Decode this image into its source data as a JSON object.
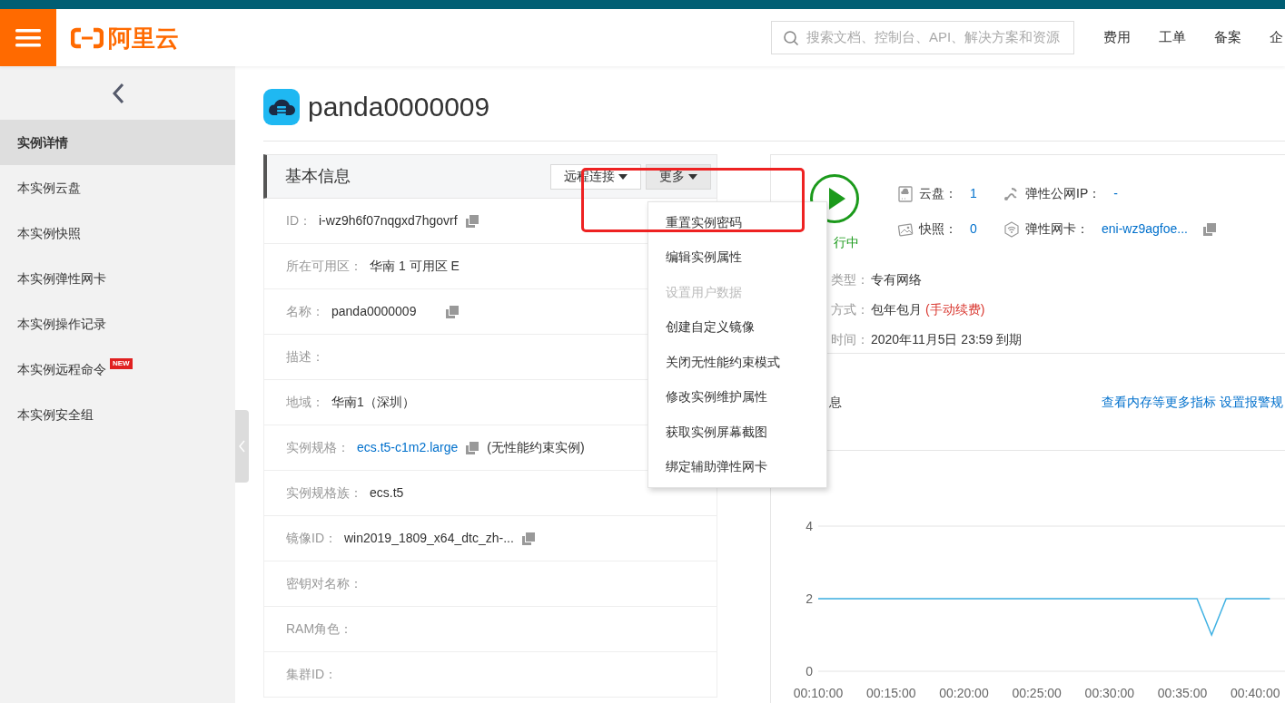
{
  "header": {
    "logo": "阿里云",
    "search": {
      "placeholder": "搜索文档、控制台、API、解决方案和资源"
    },
    "nav": [
      "费用",
      "工单",
      "备案",
      "企"
    ]
  },
  "sidebar": {
    "items": [
      {
        "label": "实例详情",
        "selected": true
      },
      {
        "label": "本实例云盘",
        "selected": false
      },
      {
        "label": "本实例快照",
        "selected": false
      },
      {
        "label": "本实例弹性网卡",
        "selected": false
      },
      {
        "label": "本实例操作记录",
        "selected": false
      },
      {
        "label": "本实例远程命令",
        "selected": false,
        "badge": "NEW"
      },
      {
        "label": "本实例安全组",
        "selected": false
      }
    ]
  },
  "instance": {
    "name": "panda0000009"
  },
  "basic_info": {
    "title": "基本信息",
    "buttons": [
      {
        "label": "远程连接",
        "active": false
      },
      {
        "label": "更多",
        "active": true
      }
    ],
    "rows": [
      {
        "label": "ID：",
        "value": "i-wz9h6f07nqgxd7hgovrf",
        "copy": true
      },
      {
        "label": "所在可用区：",
        "value": "华南 1 可用区 E"
      },
      {
        "label": "名称：",
        "value": "panda0000009",
        "copy": true
      },
      {
        "label": "描述："
      },
      {
        "label": "地域：",
        "value": "华南1（深圳）"
      },
      {
        "label": "实例规格：",
        "value": "ecs.t5-c1m2.large",
        "link": true,
        "copy": true,
        "note": "(无性能约束实例)"
      },
      {
        "label": "实例规格族：",
        "value": "ecs.t5"
      },
      {
        "label": "镜像ID：",
        "value": "win2019_1809_x64_dtc_zh-...",
        "copy": true
      },
      {
        "label": "密钥对名称："
      },
      {
        "label": "RAM角色："
      },
      {
        "label": "集群ID："
      }
    ]
  },
  "menu": {
    "items": [
      {
        "label": "重置实例密码",
        "disabled": false,
        "highlighted": true
      },
      {
        "label": "编辑实例属性",
        "disabled": false,
        "highlighted": false
      },
      {
        "label": "设置用户数据",
        "disabled": true,
        "highlighted": false
      },
      {
        "label": "创建自定义镜像",
        "disabled": false,
        "highlighted": false
      },
      {
        "label": "关闭无性能约束模式",
        "disabled": false,
        "highlighted": false
      },
      {
        "label": "修改实例维护属性",
        "disabled": false,
        "highlighted": false
      },
      {
        "label": "获取实例屏幕截图",
        "disabled": false,
        "highlighted": false
      },
      {
        "label": "绑定辅助弹性网卡",
        "disabled": false,
        "highlighted": false
      }
    ]
  },
  "status": {
    "label": "行中",
    "running": true
  },
  "stats": [
    {
      "kind": "disk",
      "label": "云盘：",
      "value": "1"
    },
    {
      "kind": "ip",
      "label": "弹性公网IP：",
      "value": "-"
    },
    {
      "kind": "snapshot",
      "label": "快照：",
      "value": "0"
    },
    {
      "kind": "nic",
      "label": "弹性网卡：",
      "value": "eni-wz9agfoe...",
      "copy": true
    }
  ],
  "details": [
    {
      "label": "类型：",
      "value": "专有网络"
    },
    {
      "label": "方式：",
      "value": "包年包月",
      "note": "(手动续费)"
    },
    {
      "label": "时间：",
      "value": "2020年11月5日 23:59 到期"
    }
  ],
  "monitor": {
    "title": "息",
    "links": [
      "查看内存等更多指标",
      "设置报警规"
    ],
    "chart_data": {
      "type": "line",
      "x": [
        10,
        15,
        20,
        25,
        30,
        35,
        36,
        37,
        38,
        40,
        41
      ],
      "series": [
        {
          "color": "#3fb1e3",
          "values": [
            2,
            2,
            2,
            2,
            2,
            2,
            2,
            1,
            2,
            2,
            2
          ]
        }
      ],
      "xlim": [
        10,
        42.1
      ],
      "ylim": [
        0,
        4
      ],
      "yticks": [
        0,
        2,
        4
      ],
      "xticks": [
        {
          "value": 10,
          "label": "00:10:00"
        },
        {
          "value": 15,
          "label": "00:15:00"
        },
        {
          "value": 20,
          "label": "00:20:00"
        },
        {
          "value": 25,
          "label": "00:25:00"
        },
        {
          "value": 30,
          "label": "00:30:00"
        },
        {
          "value": 35,
          "label": "00:35:00"
        },
        {
          "value": 40,
          "label": "00:40:00"
        }
      ]
    }
  }
}
